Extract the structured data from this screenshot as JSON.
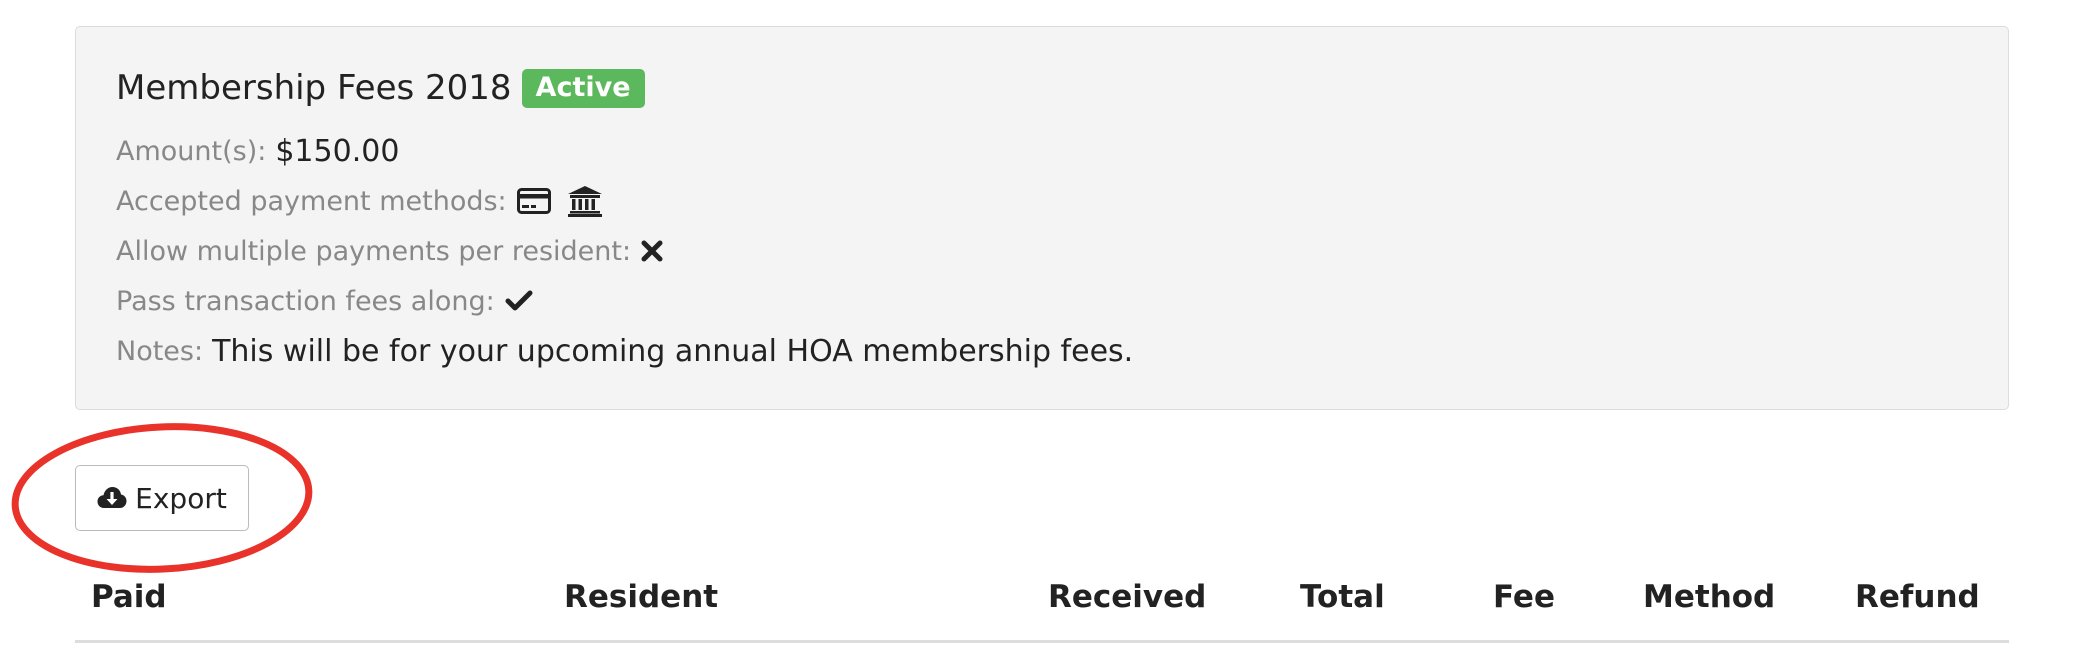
{
  "fee": {
    "title": "Membership Fees 2018",
    "status_badge": "Active",
    "status_color": "#5cb85c",
    "amounts_label": "Amount(s):",
    "amounts_value": "$150.00",
    "payment_methods_label": "Accepted payment methods:",
    "payment_method_icons": [
      "credit-card-icon",
      "bank-icon"
    ],
    "multiple_payments_label": "Allow multiple payments per resident:",
    "multiple_payments_icon": "times-icon",
    "pass_fees_label": "Pass transaction fees along:",
    "pass_fees_icon": "check-icon",
    "notes_label": "Notes:",
    "notes_value": "This will be for your upcoming annual HOA membership fees."
  },
  "toolbar": {
    "export_label": "Export",
    "export_icon": "cloud-download-icon"
  },
  "table": {
    "columns": [
      "Paid",
      "Resident",
      "Received",
      "Total",
      "Fee",
      "Method",
      "Refund"
    ]
  },
  "annotation": {
    "highlight_color": "#e8322a"
  }
}
